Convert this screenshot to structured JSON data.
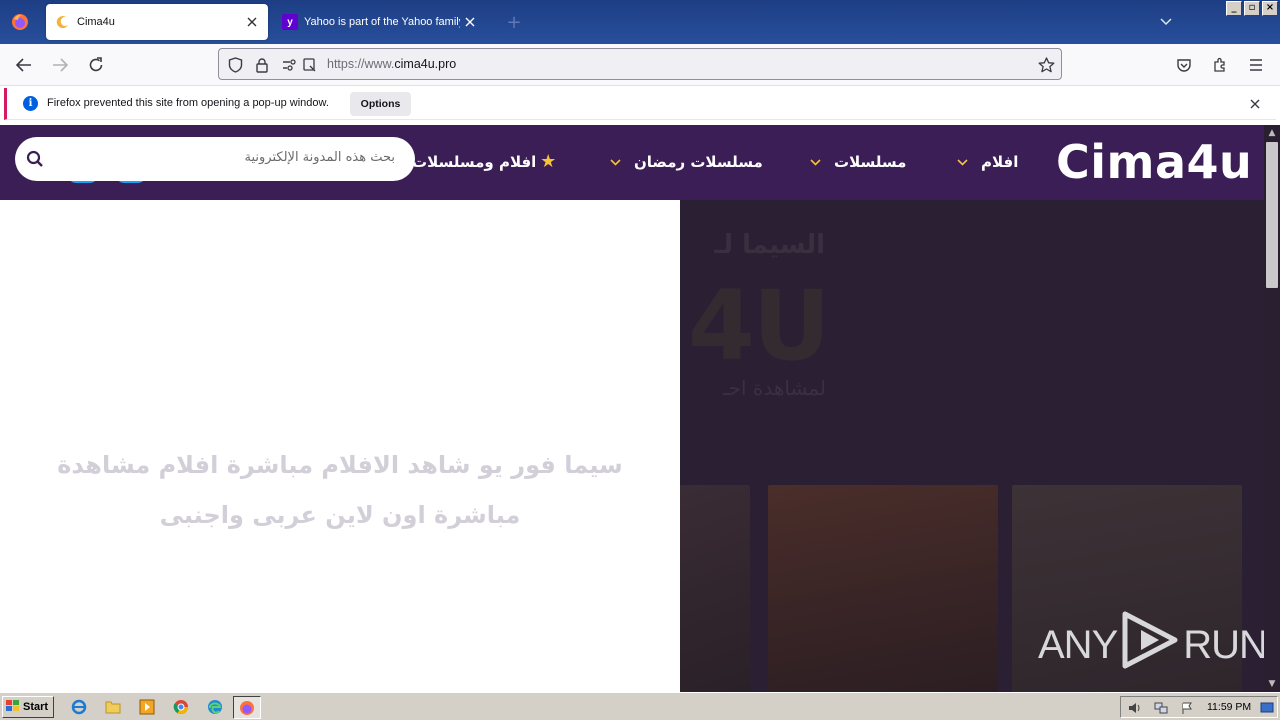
{
  "browser": {
    "tabs": [
      {
        "title": "Cima4u",
        "active": true
      },
      {
        "title": "Yahoo is part of the Yahoo family o",
        "active": false
      }
    ],
    "url": {
      "prefix": "https://www.",
      "domain": "cima4u.pro"
    },
    "notification": {
      "message": "Firefox prevented this site from opening a pop-up window.",
      "options_label": "Options"
    }
  },
  "site": {
    "logo": "Cima4u",
    "menu": [
      {
        "label": "افلام",
        "has_dropdown": true
      },
      {
        "label": "مسلسلات",
        "has_dropdown": true
      },
      {
        "label": "مسلسلات رمضان",
        "has_dropdown": true
      },
      {
        "label": "افلام ومسلسلات",
        "has_star": true
      }
    ],
    "search_placeholder": "بحث هذه المدونة الإلكترونية",
    "hero_text": "سيما فور يو شاهد الافلام مباشرة افلام مشاهدة مباشرة اون لاين عربى واجنبى",
    "hero_bg_title": "السيما لـ",
    "hero_bg_logo": "4U",
    "hero_bg_sub": "لمشاهدة احـ"
  },
  "watermark": {
    "text_left": "ANY",
    "text_right": "RUN"
  },
  "taskbar": {
    "start_label": "Start",
    "clock": "11:59 PM"
  },
  "colors": {
    "site_header": "#3b1e55",
    "hero_dark": "#2b2033",
    "hero_text": "#d2cfd8",
    "star": "#f5c23c",
    "accent_notif": "#d51a63"
  }
}
